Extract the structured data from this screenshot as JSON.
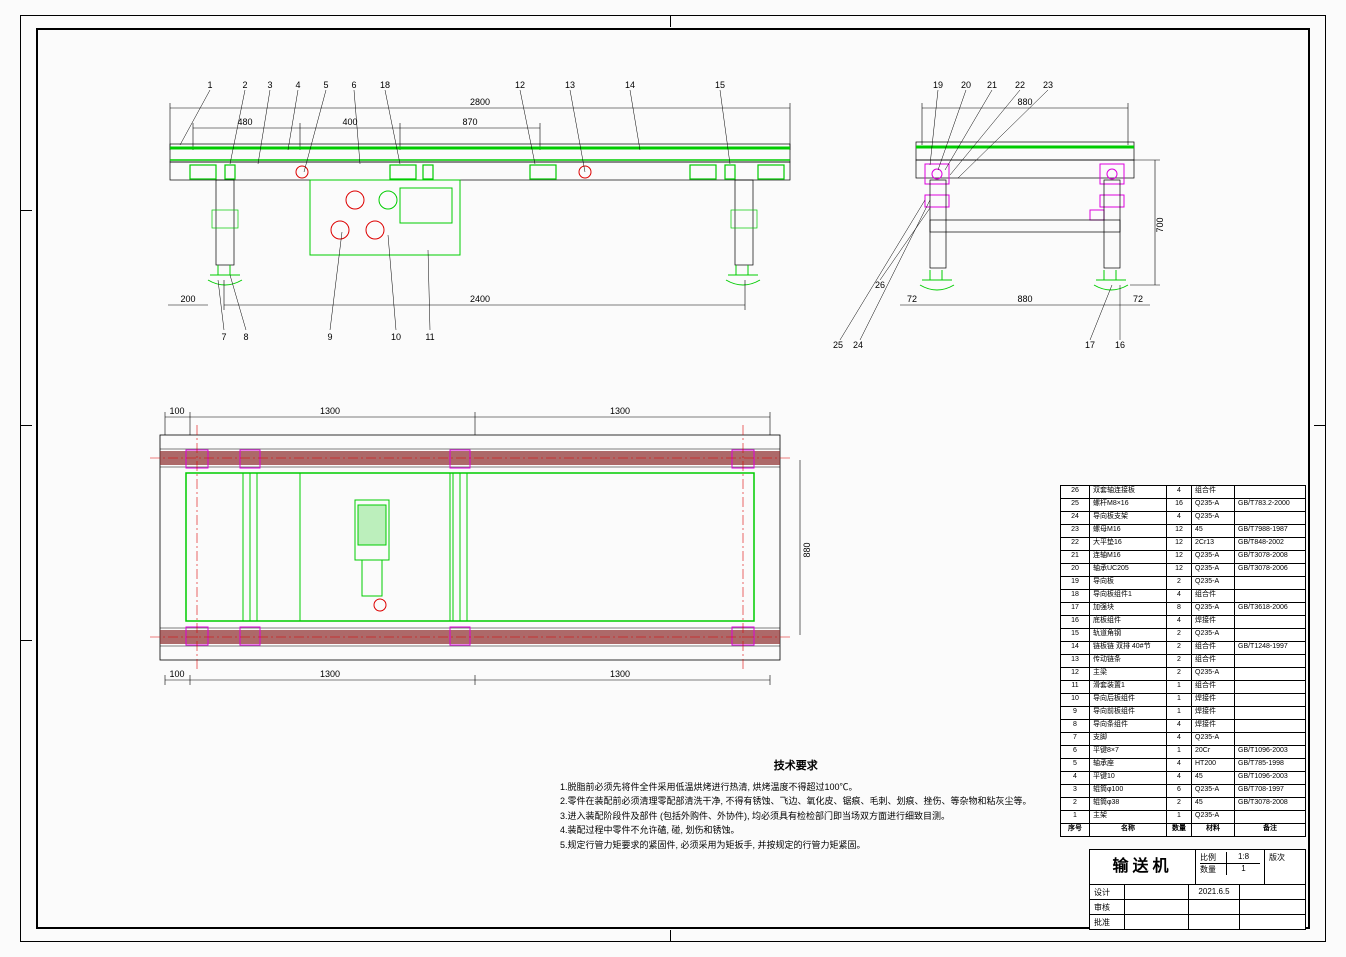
{
  "title_block": {
    "title": "输送机",
    "scale_label": "比例",
    "scale": "1:8",
    "rev_label": "版次",
    "rev": "",
    "qty_label": "数量",
    "qty": "1",
    "date": "2021.6.5",
    "col_des": "设计",
    "col_chk": "审核",
    "col_app": "批准"
  },
  "parts_header": {
    "no": "序号",
    "name": "名称",
    "qty": "数量",
    "mat": "材料",
    "note": "备注"
  },
  "parts": [
    {
      "no": "1",
      "name": "主架",
      "qty": "1",
      "mat": "Q235-A",
      "note": ""
    },
    {
      "no": "2",
      "name": "辊筒φ38",
      "qty": "2",
      "mat": "45",
      "note": "GB/T3078-2008"
    },
    {
      "no": "3",
      "name": "辊筒φ100",
      "qty": "6",
      "mat": "Q235-A",
      "note": "GB/T708-1997"
    },
    {
      "no": "4",
      "name": "平键10",
      "qty": "4",
      "mat": "45",
      "note": "GB/T1096-2003"
    },
    {
      "no": "5",
      "name": "轴承座",
      "qty": "4",
      "mat": "HT200",
      "note": "GB/T785-1998"
    },
    {
      "no": "6",
      "name": "平键8×7",
      "qty": "1",
      "mat": "20Cr",
      "note": "GB/T1096-2003"
    },
    {
      "no": "7",
      "name": "支脚",
      "qty": "4",
      "mat": "Q235-A",
      "note": ""
    },
    {
      "no": "8",
      "name": "导向条组件",
      "qty": "4",
      "mat": "焊接件",
      "note": ""
    },
    {
      "no": "9",
      "name": "导向前板组件",
      "qty": "1",
      "mat": "焊接件",
      "note": ""
    },
    {
      "no": "10",
      "name": "导向后板组件",
      "qty": "1",
      "mat": "焊接件",
      "note": ""
    },
    {
      "no": "11",
      "name": "滑套装置1",
      "qty": "1",
      "mat": "组合件",
      "note": ""
    },
    {
      "no": "12",
      "name": "主梁",
      "qty": "2",
      "mat": "Q235-A",
      "note": ""
    },
    {
      "no": "13",
      "name": "传动链条",
      "qty": "2",
      "mat": "组合件",
      "note": ""
    },
    {
      "no": "14",
      "name": "链板链 双排 40#节",
      "qty": "2",
      "mat": "组合件",
      "note": "GB/T1248-1997"
    },
    {
      "no": "15",
      "name": "轨道角钢",
      "qty": "2",
      "mat": "Q235-A",
      "note": ""
    },
    {
      "no": "16",
      "name": "底板组件",
      "qty": "4",
      "mat": "焊接件",
      "note": ""
    },
    {
      "no": "17",
      "name": "加强块",
      "qty": "8",
      "mat": "Q235-A",
      "note": "GB/T3618-2006"
    },
    {
      "no": "18",
      "name": "导向板组件1",
      "qty": "4",
      "mat": "组合件",
      "note": ""
    },
    {
      "no": "19",
      "name": "导向板",
      "qty": "2",
      "mat": "Q235-A",
      "note": ""
    },
    {
      "no": "20",
      "name": "轴承UC205",
      "qty": "12",
      "mat": "Q235-A",
      "note": "GB/T3078-2006"
    },
    {
      "no": "21",
      "name": "连轴M16",
      "qty": "12",
      "mat": "Q235-A",
      "note": "GB/T3078-2008"
    },
    {
      "no": "22",
      "name": "大平垫16",
      "qty": "12",
      "mat": "2Cr13",
      "note": "GB/T848-2002"
    },
    {
      "no": "23",
      "name": "螺母M16",
      "qty": "12",
      "mat": "45",
      "note": "GB/T7988-1987"
    },
    {
      "no": "24",
      "name": "导向板支架",
      "qty": "4",
      "mat": "Q235-A",
      "note": ""
    },
    {
      "no": "25",
      "name": "螺杆M8×16",
      "qty": "16",
      "mat": "Q235-A",
      "note": "GB/T783.2-2000"
    },
    {
      "no": "26",
      "name": "双套轴连接板",
      "qty": "4",
      "mat": "组合件",
      "note": ""
    }
  ],
  "notes": {
    "title": "技术要求",
    "lines": [
      "1.脱脂前必须先将件全件采用低温烘烤进行热清, 烘烤温度不得超过100℃。",
      "2.零件在装配前必须清理零配部清洗干净, 不得有锈蚀、飞边、氧化皮、锯痕、毛刺、划痕、挫伤、等杂物和粘灰尘等。",
      "3.进入装配阶段件及部件 (包括外购件、外协件), 均必须具有检检部门即当场双方面进行细致目测。",
      "4.装配过程中零件不允许磕, 碰, 划伤和锈蚀。",
      "5.规定行管力矩要求的紧固件, 必须采用为矩扳手, 并按规定的行管力矩紧固。"
    ]
  },
  "dims_front": {
    "overall": "2800",
    "left": "480",
    "mid1": "400",
    "mid2": "870",
    "span": "2400",
    "offL": "200"
  },
  "dims_side": {
    "overall": "880",
    "inner": "880",
    "h": "700",
    "foot": "72",
    "foot2": "72"
  },
  "dims_top": {
    "l1": "100",
    "l2": "1300",
    "l3": "1300",
    "l4": "100",
    "l5": "1300",
    "l6": "1300",
    "w": "880"
  },
  "balloons_front": [
    "1",
    "2",
    "3",
    "4",
    "5",
    "6",
    "18",
    "12",
    "13",
    "14",
    "15"
  ],
  "balloons_front_low": [
    "7",
    "8",
    "9",
    "10",
    "11"
  ],
  "balloons_side_top": [
    "19",
    "20",
    "21",
    "22",
    "23"
  ],
  "balloons_side_low": [
    "25",
    "24",
    "26",
    "17",
    "16"
  ]
}
